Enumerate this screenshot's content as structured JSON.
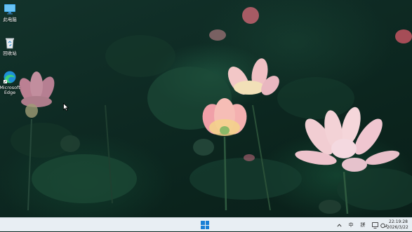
{
  "desktop": {
    "icons": [
      {
        "label": "此电脑",
        "icon": "computer-icon"
      },
      {
        "label": "回收站",
        "icon": "recycle-bin-icon"
      },
      {
        "label": "Microsoft\nEdge",
        "icon": "edge-icon"
      }
    ]
  },
  "taskbar": {
    "start_icon": "windows-logo-icon",
    "tray": {
      "chevron": "^",
      "input_mode": "中",
      "ime_label": "拼",
      "time": "22:19:28",
      "date": "2026/3/22"
    }
  },
  "colors": {
    "start_blue": "#1a7fd6",
    "taskbar_bg": "#e8eef3"
  }
}
